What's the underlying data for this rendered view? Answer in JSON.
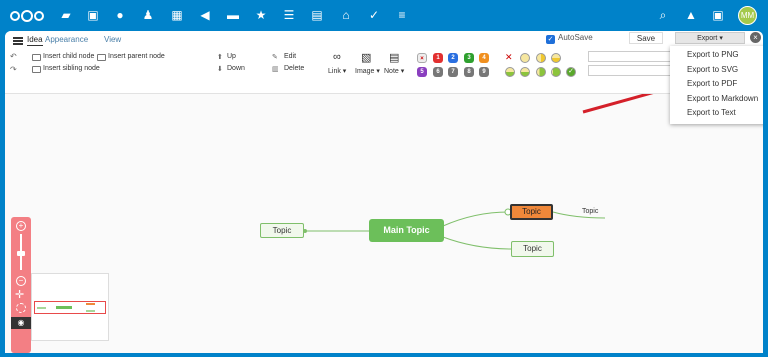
{
  "header": {
    "nav_icons": [
      "files-icon",
      "photos-icon",
      "activity-icon",
      "contacts-icon",
      "calendar-icon",
      "audio-icon",
      "deck-icon",
      "favorites-icon",
      "tasks-icon",
      "notes-icon",
      "news-icon",
      "checklist-icon",
      "text-icon"
    ],
    "avatar_initials": "MM",
    "accent": "#0082c9"
  },
  "tabs": [
    "Idea",
    "Appearance",
    "View"
  ],
  "toolbar": {
    "insert_child": "Insert child node",
    "insert_parent": "Insert parent node",
    "insert_sibling": "Insert sibling node",
    "up": "Up",
    "down": "Down",
    "edit": "Edit",
    "delete": "Delete",
    "link": "Link",
    "image": "Image",
    "note": "Note",
    "priorities_top": [
      "×",
      "1",
      "2",
      "3",
      "4"
    ],
    "priorities_bottom": [
      "5",
      "6",
      "7",
      "8",
      "9"
    ],
    "autosave_label": "AutoSave",
    "save_label": "Save",
    "export_label": "Export",
    "close_label": "×"
  },
  "export_menu": [
    "Export to PNG",
    "Export to SVG",
    "Export to PDF",
    "Export to Markdown",
    "Export to Text"
  ],
  "mindmap": {
    "main": "Main Topic",
    "left": "Topic",
    "right_top": "Topic",
    "right_bottom": "Topic",
    "sub": "Topic"
  },
  "colors": {
    "main_node": "#6cbf5a",
    "selected_node": "#f0883a",
    "zoom_panel": "#f37f84",
    "arrow": "#d4202a"
  }
}
